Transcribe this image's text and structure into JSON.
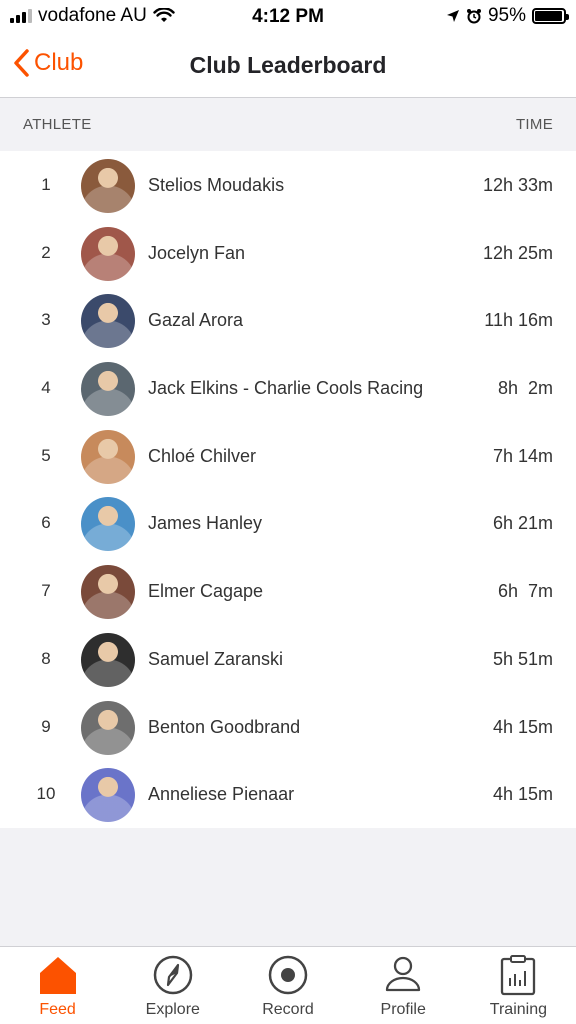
{
  "status": {
    "carrier": "vodafone AU",
    "time": "4:12 PM",
    "battery": "95%",
    "battery_level": 0.95
  },
  "nav": {
    "back_label": "Club",
    "title": "Club Leaderboard"
  },
  "columns": {
    "athlete": "ATHLETE",
    "time": "TIME"
  },
  "leaderboard": [
    {
      "rank": "1",
      "name": "Stelios Moudakis",
      "time": "12h 33m",
      "avatar_color": "#8a5a3c"
    },
    {
      "rank": "2",
      "name": "Jocelyn Fan",
      "time": "12h 25m",
      "avatar_color": "#a0574a"
    },
    {
      "rank": "3",
      "name": "Gazal Arora",
      "time": "11h 16m",
      "avatar_color": "#3b4a6b"
    },
    {
      "rank": "4",
      "name": "Jack Elkins - Charlie Cools Racing",
      "time": "8h  2m",
      "avatar_color": "#5b6770"
    },
    {
      "rank": "5",
      "name": "Chloé Chilver",
      "time": "7h 14m",
      "avatar_color": "#c78a5c"
    },
    {
      "rank": "6",
      "name": "James Hanley",
      "time": "6h 21m",
      "avatar_color": "#4a90c8"
    },
    {
      "rank": "7",
      "name": "Elmer Cagape",
      "time": "6h  7m",
      "avatar_color": "#7a4a3a"
    },
    {
      "rank": "8",
      "name": "Samuel Zaranski",
      "time": "5h 51m",
      "avatar_color": "#2e2e2e"
    },
    {
      "rank": "9",
      "name": "Benton Goodbrand",
      "time": "4h 15m",
      "avatar_color": "#6e6e6e"
    },
    {
      "rank": "10",
      "name": "Anneliese Pienaar",
      "time": "4h 15m",
      "avatar_color": "#6a74c9"
    }
  ],
  "tabs": [
    {
      "label": "Feed",
      "icon": "home-icon",
      "active": true
    },
    {
      "label": "Explore",
      "icon": "compass-icon",
      "active": false
    },
    {
      "label": "Record",
      "icon": "record-icon",
      "active": false
    },
    {
      "label": "Profile",
      "icon": "profile-icon",
      "active": false
    },
    {
      "label": "Training",
      "icon": "training-icon",
      "active": false
    }
  ],
  "colors": {
    "accent": "#fc5200"
  }
}
